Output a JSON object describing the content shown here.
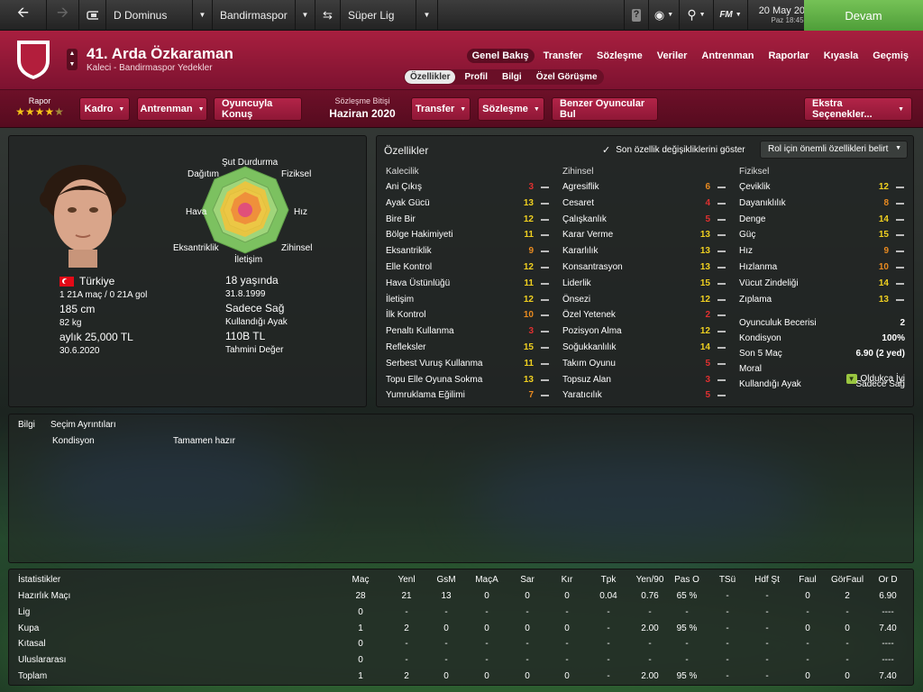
{
  "topbar": {
    "manager": "D Dominus",
    "club": "Bandirmaspor",
    "competition": "Süper Lig",
    "date": "20 May 2018",
    "day_time": "Paz 18:45",
    "continue_label": "Devam"
  },
  "player": {
    "name": "41. Arda Özkaraman",
    "subtitle": "Kaleci - Bandirmaspor Yedekler",
    "nation": "Türkiye",
    "caps": "1 21A maç / 0 21A gol",
    "height": "185 cm",
    "weight": "82 kg",
    "wage": "aylık 25,000 TL",
    "contract_end": "30.6.2020",
    "age": "18 yaşında",
    "dob": "31.8.1999",
    "foot_value": "Sadece Sağ",
    "foot_label": "Kullandığı Ayak",
    "value": "110B TL",
    "value_label": "Tahmini Değer"
  },
  "nav": {
    "tabs": [
      "Genel Bakış",
      "Transfer",
      "Sözleşme",
      "Veriler",
      "Antrenman",
      "Raporlar",
      "Kıyasla",
      "Geçmiş"
    ],
    "subtabs": [
      "Özellikler",
      "Profil",
      "Bilgi",
      "Özel Görüşme"
    ]
  },
  "toolbar": {
    "rapor_label": "Rapor",
    "stars": "★★★★",
    "star_dim": "★",
    "squad": "Kadro",
    "training": "Antrenman",
    "talk": "Oyuncuyla Konuş",
    "contract_label": "Sözleşme Bitişi",
    "contract_value": "Haziran 2020",
    "transfer": "Transfer",
    "contract_btn": "Sözleşme",
    "similar": "Benzer Oyuncular Bul",
    "extra": "Ekstra Seçenekler..."
  },
  "radar": {
    "labels": [
      "Şut Durdurma",
      "Fiziksel",
      "Hız",
      "Zihinsel",
      "İletişim",
      "Eksantriklik",
      "Hava",
      "Dağıtım"
    ]
  },
  "attributes": {
    "title": "Özellikler",
    "checkbox_label": "Son özellik değişikliklerini göster",
    "role_select": "Rol için önemli özellikleri belirt",
    "goalkeeping_title": "Kalecilik",
    "mental_title": "Zihinsel",
    "physical_title": "Fiziksel",
    "goalkeeping": [
      {
        "name": "Ani Çıkış",
        "value": "3",
        "color": "#e03030"
      },
      {
        "name": "Ayak Gücü",
        "value": "13",
        "color": "#f0d020"
      },
      {
        "name": "Bire Bir",
        "value": "12",
        "color": "#f0d020"
      },
      {
        "name": "Bölge Hakimiyeti",
        "value": "11",
        "color": "#f0d020"
      },
      {
        "name": "Eksantriklik",
        "value": "9",
        "color": "#e88a20"
      },
      {
        "name": "Elle Kontrol",
        "value": "12",
        "color": "#f0d020"
      },
      {
        "name": "Hava Üstünlüğü",
        "value": "11",
        "color": "#f0d020"
      },
      {
        "name": "İletişim",
        "value": "12",
        "color": "#f0d020"
      },
      {
        "name": "İlk Kontrol",
        "value": "10",
        "color": "#e88a20"
      },
      {
        "name": "Penaltı Kullanma",
        "value": "3",
        "color": "#e03030"
      },
      {
        "name": "Refleksler",
        "value": "15",
        "color": "#f0d020"
      },
      {
        "name": "Serbest Vuruş Kullanma",
        "value": "11",
        "color": "#f0d020"
      },
      {
        "name": "Topu Elle Oyuna Sokma",
        "value": "13",
        "color": "#f0d020"
      },
      {
        "name": "Yumruklama Eğilimi",
        "value": "7",
        "color": "#e88a20"
      }
    ],
    "mental": [
      {
        "name": "Agresiflik",
        "value": "6",
        "color": "#e88a20"
      },
      {
        "name": "Cesaret",
        "value": "4",
        "color": "#e03030"
      },
      {
        "name": "Çalışkanlık",
        "value": "5",
        "color": "#e03030"
      },
      {
        "name": "Karar Verme",
        "value": "13",
        "color": "#f0d020"
      },
      {
        "name": "Kararlılık",
        "value": "13",
        "color": "#f0d020"
      },
      {
        "name": "Konsantrasyon",
        "value": "13",
        "color": "#f0d020"
      },
      {
        "name": "Liderlik",
        "value": "15",
        "color": "#f0d020"
      },
      {
        "name": "Önsezi",
        "value": "12",
        "color": "#f0d020"
      },
      {
        "name": "Özel Yetenek",
        "value": "2",
        "color": "#e03030"
      },
      {
        "name": "Pozisyon Alma",
        "value": "12",
        "color": "#f0d020"
      },
      {
        "name": "Soğukkanlılık",
        "value": "14",
        "color": "#f0d020"
      },
      {
        "name": "Takım Oyunu",
        "value": "5",
        "color": "#e03030"
      },
      {
        "name": "Topsuz Alan",
        "value": "3",
        "color": "#e03030"
      },
      {
        "name": "Yaratıcılık",
        "value": "5",
        "color": "#e03030"
      }
    ],
    "physical": [
      {
        "name": "Çeviklik",
        "value": "12",
        "color": "#f0d020"
      },
      {
        "name": "Dayanıklılık",
        "value": "8",
        "color": "#e88a20"
      },
      {
        "name": "Denge",
        "value": "14",
        "color": "#f0d020"
      },
      {
        "name": "Güç",
        "value": "15",
        "color": "#f0d020"
      },
      {
        "name": "Hız",
        "value": "9",
        "color": "#e88a20"
      },
      {
        "name": "Hızlanma",
        "value": "10",
        "color": "#e88a20"
      },
      {
        "name": "Vücut Zindeliği",
        "value": "14",
        "color": "#f0d020"
      },
      {
        "name": "Zıplama",
        "value": "13",
        "color": "#f0d020"
      }
    ],
    "summary": [
      {
        "name": "Oyunculuk Becerisi",
        "value": "2"
      },
      {
        "name": "Kondisyon",
        "value": "100%"
      },
      {
        "name": "Son 5 Maç",
        "value": "6.90 (2 yed)"
      },
      {
        "name": "Moral",
        "value": "Oldukça İyi"
      },
      {
        "name": "Kullandığı Ayak",
        "value": "Sadece Sağ"
      }
    ]
  },
  "info": {
    "tab1": "Bilgi",
    "tab2": "Seçim Ayrıntıları",
    "row_label": "Kondisyon",
    "row_value": "Tamamen hazır"
  },
  "stats": {
    "title": "İstatistikler",
    "headers": [
      "Maç",
      "Yenl",
      "GsM",
      "MaçA",
      "Sar",
      "Kır",
      "Tpk",
      "Yen/90",
      "Pas O",
      "TSü",
      "Hdf Şt",
      "Faul",
      "GörFaul",
      "Or D"
    ],
    "rows": [
      {
        "label": "Hazırlık Maçı",
        "cells": [
          "28",
          "21",
          "13",
          "0",
          "0",
          "0",
          "0.04",
          "0.76",
          "65 %",
          "-",
          "-",
          "0",
          "2",
          "6.90"
        ]
      },
      {
        "label": "Lig",
        "cells": [
          "0",
          "-",
          "-",
          "-",
          "-",
          "-",
          "-",
          "-",
          "-",
          "-",
          "-",
          "-",
          "-",
          "----"
        ]
      },
      {
        "label": "Kupa",
        "cells": [
          "1",
          "2",
          "0",
          "0",
          "0",
          "0",
          "-",
          "2.00",
          "95 %",
          "-",
          "-",
          "0",
          "0",
          "7.40"
        ]
      },
      {
        "label": "Kıtasal",
        "cells": [
          "0",
          "-",
          "-",
          "-",
          "-",
          "-",
          "-",
          "-",
          "-",
          "-",
          "-",
          "-",
          "-",
          "----"
        ]
      },
      {
        "label": "Uluslararası",
        "cells": [
          "0",
          "-",
          "-",
          "-",
          "-",
          "-",
          "-",
          "-",
          "-",
          "-",
          "-",
          "-",
          "-",
          "----"
        ]
      },
      {
        "label": "Toplam",
        "cells": [
          "1",
          "2",
          "0",
          "0",
          "0",
          "0",
          "-",
          "2.00",
          "95 %",
          "-",
          "-",
          "0",
          "0",
          "7.40"
        ]
      }
    ]
  }
}
